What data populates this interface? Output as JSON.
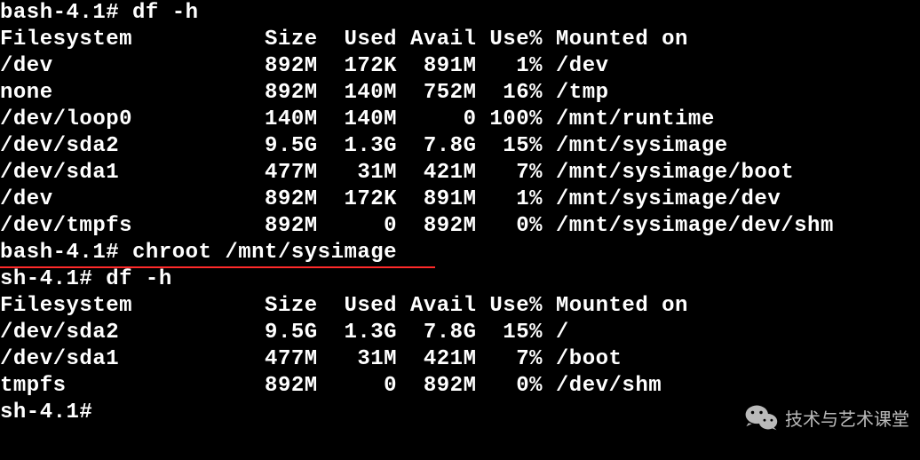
{
  "lines": [
    {
      "prompt": "bash-4.1# ",
      "cmd": "df -h"
    },
    {
      "text": "Filesystem          Size  Used Avail Use% Mounted on"
    },
    {
      "text": "/dev                892M  172K  891M   1% /dev"
    },
    {
      "text": "none                892M  140M  752M  16% /tmp"
    },
    {
      "text": "/dev/loop0          140M  140M     0 100% /mnt/runtime"
    },
    {
      "text": "/dev/sda2           9.5G  1.3G  7.8G  15% /mnt/sysimage"
    },
    {
      "text": "/dev/sda1           477M   31M  421M   7% /mnt/sysimage/boot"
    },
    {
      "text": "/dev                892M  172K  891M   1% /mnt/sysimage/dev"
    },
    {
      "text": "/dev/tmpfs          892M     0  892M   0% /mnt/sysimage/dev/shm"
    },
    {
      "prompt": "bash-4.1# ",
      "cmd": "chroot /mnt/sysimage",
      "underline": true
    },
    {
      "prompt": "sh-4.1# ",
      "cmd": "df -h"
    },
    {
      "text": "Filesystem          Size  Used Avail Use% Mounted on"
    },
    {
      "text": "/dev/sda2           9.5G  1.3G  7.8G  15% /"
    },
    {
      "text": "/dev/sda1           477M   31M  421M   7% /boot"
    },
    {
      "text": "tmpfs               892M     0  892M   0% /dev/shm"
    },
    {
      "prompt": "sh-4.1# ",
      "cmd": ""
    }
  ],
  "watermark": {
    "text": "技术与艺术课堂",
    "icon": "wechat-icon"
  },
  "chart_data": {
    "type": "table",
    "title": "df -h output (before and after chroot)",
    "columns": [
      "Filesystem",
      "Size",
      "Used",
      "Avail",
      "Use%",
      "Mounted on"
    ],
    "before_chroot": [
      {
        "Filesystem": "/dev",
        "Size": "892M",
        "Used": "172K",
        "Avail": "891M",
        "Use%": "1%",
        "Mounted on": "/dev"
      },
      {
        "Filesystem": "none",
        "Size": "892M",
        "Used": "140M",
        "Avail": "752M",
        "Use%": "16%",
        "Mounted on": "/tmp"
      },
      {
        "Filesystem": "/dev/loop0",
        "Size": "140M",
        "Used": "140M",
        "Avail": "0",
        "Use%": "100%",
        "Mounted on": "/mnt/runtime"
      },
      {
        "Filesystem": "/dev/sda2",
        "Size": "9.5G",
        "Used": "1.3G",
        "Avail": "7.8G",
        "Use%": "15%",
        "Mounted on": "/mnt/sysimage"
      },
      {
        "Filesystem": "/dev/sda1",
        "Size": "477M",
        "Used": "31M",
        "Avail": "421M",
        "Use%": "7%",
        "Mounted on": "/mnt/sysimage/boot"
      },
      {
        "Filesystem": "/dev",
        "Size": "892M",
        "Used": "172K",
        "Avail": "891M",
        "Use%": "1%",
        "Mounted on": "/mnt/sysimage/dev"
      },
      {
        "Filesystem": "/dev/tmpfs",
        "Size": "892M",
        "Used": "0",
        "Avail": "892M",
        "Use%": "0%",
        "Mounted on": "/mnt/sysimage/dev/shm"
      }
    ],
    "chroot_command": "chroot /mnt/sysimage",
    "after_chroot": [
      {
        "Filesystem": "/dev/sda2",
        "Size": "9.5G",
        "Used": "1.3G",
        "Avail": "7.8G",
        "Use%": "15%",
        "Mounted on": "/"
      },
      {
        "Filesystem": "/dev/sda1",
        "Size": "477M",
        "Used": "31M",
        "Avail": "421M",
        "Use%": "7%",
        "Mounted on": "/boot"
      },
      {
        "Filesystem": "tmpfs",
        "Size": "892M",
        "Used": "0",
        "Avail": "892M",
        "Use%": "0%",
        "Mounted on": "/dev/shm"
      }
    ]
  }
}
